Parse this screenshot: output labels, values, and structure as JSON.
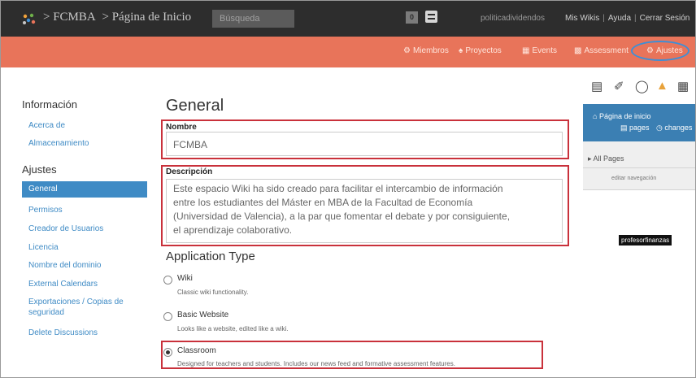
{
  "topbar": {
    "breadcrumb": [
      "> FCMBA",
      "> Página de Inicio"
    ],
    "search_placeholder": "Búsqueda",
    "notif_count": "0",
    "username": "politicadividendos",
    "links": [
      "Mis Wikis",
      "Ayuda",
      "Cerrar Sesión"
    ]
  },
  "nav": {
    "items": [
      {
        "icon": "members-icon",
        "label": "Miembros"
      },
      {
        "icon": "projects-icon",
        "label": "Proyectos"
      },
      {
        "icon": "calendar-icon",
        "label": "Events"
      },
      {
        "icon": "assessment-icon",
        "label": "Assessment"
      },
      {
        "icon": "gear-icon",
        "label": "Ajustes"
      }
    ],
    "highlight_color": "#3e8fd6"
  },
  "sidebar": {
    "info_heading": "Información",
    "info_items": [
      "Acerca de",
      "Almacenamiento"
    ],
    "settings_heading": "Ajustes",
    "settings_items": [
      {
        "label": "General",
        "active": true
      },
      {
        "label": "Permisos",
        "active": false
      },
      {
        "label": "Creador de Usuarios",
        "active": false
      },
      {
        "label": "Licencia",
        "active": false
      },
      {
        "label": "Nombre del dominio",
        "active": false
      },
      {
        "label": "External Calendars",
        "active": false
      },
      {
        "label": "Exportaciones / Copias de",
        "active": false
      },
      {
        "label": "seguridad",
        "active": false
      },
      {
        "label": "Delete Discussions",
        "active": false
      }
    ],
    "accent": "#3f8bc5"
  },
  "main": {
    "title": "General",
    "name_label": "Nombre",
    "name_value": "FCMBA",
    "desc_label": "Descripción",
    "desc_lines": [
      "Este espacio Wiki ha sido creado para facilitar el intercambio de información",
      "entre los estudiantes del Máster en MBA de la Facultad de Economía",
      "(Universidad de Valencia), a la par que fomentar el debate y por consiguiente,",
      "el aprendizaje colaborativo."
    ],
    "app_type_title": "Application Type",
    "options": [
      {
        "label": "Wiki",
        "desc": "Classic wiki functionality.",
        "checked": false
      },
      {
        "label": "Basic Website",
        "desc": "Looks like a website, edited like a wiki.",
        "checked": false
      },
      {
        "label": "Classroom",
        "desc": "Designed for teachers and students. Includes our news feed and formative assessment features.",
        "checked": true
      }
    ],
    "highlight_color": "#c9313b"
  },
  "rightpanel": {
    "tool_icons": [
      "page-icon",
      "attach-icon",
      "comment-icon",
      "sitemap-icon",
      "calendar-icon"
    ],
    "home_label": "Página de inicio",
    "pages_label": "pages",
    "changes_label": "changes",
    "all_pages": "All Pages",
    "edit_nav": "editar navegación",
    "tooltip": "profesorfinanzas",
    "accent": "#3b7fb3"
  },
  "colors": {
    "topbar": "#2d2d2d",
    "navbar": "#e8745a"
  }
}
